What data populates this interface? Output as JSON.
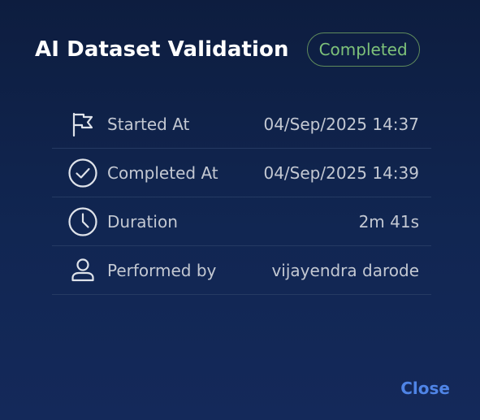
{
  "dialog": {
    "title": "AI Dataset Validation",
    "status": "Completed",
    "close_label": "Close"
  },
  "details": [
    {
      "icon": "flag-icon",
      "label": "Started At",
      "value": "04/Sep/2025 14:37"
    },
    {
      "icon": "check-circle-icon",
      "label": "Completed At",
      "value": "04/Sep/2025 14:39"
    },
    {
      "icon": "clock-icon",
      "label": "Duration",
      "value": "2m 41s"
    },
    {
      "icon": "user-icon",
      "label": "Performed by",
      "value": "vijayendra darode"
    }
  ],
  "colors": {
    "status": "#7ec27a",
    "accent": "#4f84e6"
  }
}
